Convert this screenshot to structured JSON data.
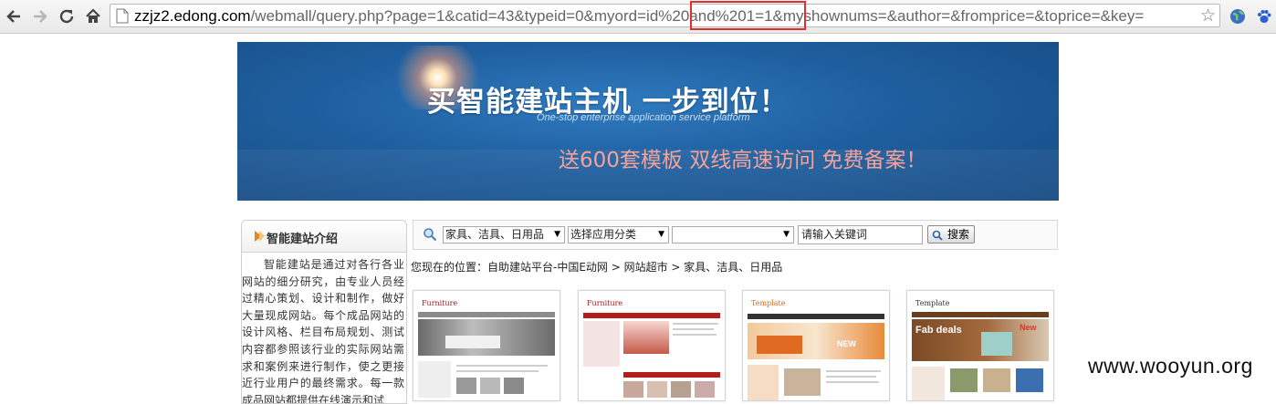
{
  "browser": {
    "url_host": "zzjz2.edong.com",
    "url_path": "/webmall/query.php?page=1&catid=43&typeid=0&myord=id%20and%201=1&myshownums=&author=&fromprice=&toprice=&key=",
    "icons": [
      "back-icon",
      "forward-icon",
      "reload-icon",
      "home-icon",
      "page-icon",
      "star-icon",
      "globe-extension-icon",
      "paw-extension-icon"
    ],
    "highlight_color": "#e0302e"
  },
  "banner": {
    "title": "买智能建站主机  一步到位！",
    "subtitle": "One-stop enterprise application service platform",
    "promo": "送600套模板  双线高速访问  免费备案！"
  },
  "sidebar": {
    "title": "智能建站介绍",
    "text": "智能建站是通过对各行各业网站的细分研究，由专业人员经过精心策划、设计和制作，做好大量现成网站。每个成品网站的设计风格、栏目布局规划、测试内容都参照该行业的实际网站需求和案例来进行制作，使之更接近行业用户的最终需求。每一款成品网站都提供在线演示和试"
  },
  "search": {
    "category_selected": "家具、洁具、日用品",
    "app_category_selected": "选择应用分类",
    "third_select_value": "",
    "keyword_value": "请输入关键词",
    "button_label": "搜索"
  },
  "breadcrumb": {
    "text": "您现在的位置：自助建站平台-中国E动网 > 网站超市 > 家具、洁具、日用品"
  },
  "thumbnails": [
    {
      "logo": "Furniture",
      "alt": "furniture-template-thumbnail"
    },
    {
      "logo": "Furniture",
      "alt": "red-furniture-template-thumbnail"
    },
    {
      "logo": "Template",
      "badge": "NEW",
      "alt": "orange-template-thumbnail"
    },
    {
      "logo": "Template",
      "headline": "Fab deals",
      "badge": "New",
      "alt": "brown-template-thumbnail"
    }
  ],
  "watermark": "www.wooyun.org",
  "colors": {
    "banner_blue": "#1f5f9f",
    "promo_pink": "#f4a29a",
    "accent_orange": "#e08a1e"
  }
}
